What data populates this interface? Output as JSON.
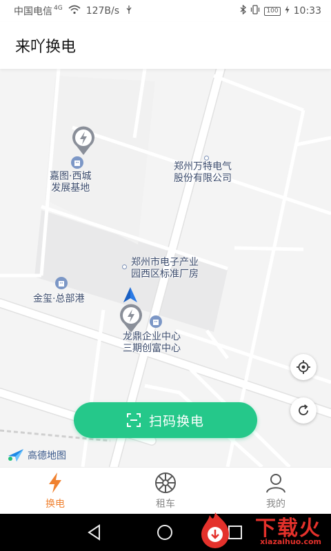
{
  "status_bar": {
    "carrier": "中国电信",
    "network": "4G",
    "speed": "127B/s",
    "battery": "100",
    "time": "10:33"
  },
  "header": {
    "title": "来吖换电"
  },
  "map": {
    "labels": {
      "jiatu_line1": "嘉图·西城",
      "jiatu_line2": "发展基地",
      "wante_line1": "郑州万特电气",
      "wante_line2": "股份有限公司",
      "dianzi_line1": "郑州市电子产业",
      "dianzi_line2": "园西区标准厂房",
      "jinxi": "金玺·总部港",
      "longding_line1": "龙鼎企业中心",
      "longding_line2": "三期创富中心"
    },
    "attribution": "高德地图"
  },
  "scan_button": {
    "label": "扫码换电"
  },
  "tabs": [
    {
      "label": "换电",
      "icon": "lightning-icon",
      "active": true
    },
    {
      "label": "租车",
      "icon": "wheel-icon",
      "active": false
    },
    {
      "label": "我的",
      "icon": "user-icon",
      "active": false
    }
  ],
  "watermark": {
    "text": "下载火",
    "url": "xiazaihuo.com"
  },
  "colors": {
    "accent": "#25c88a",
    "tab_active": "#f0812f",
    "station_pin": "#8a8f99"
  }
}
